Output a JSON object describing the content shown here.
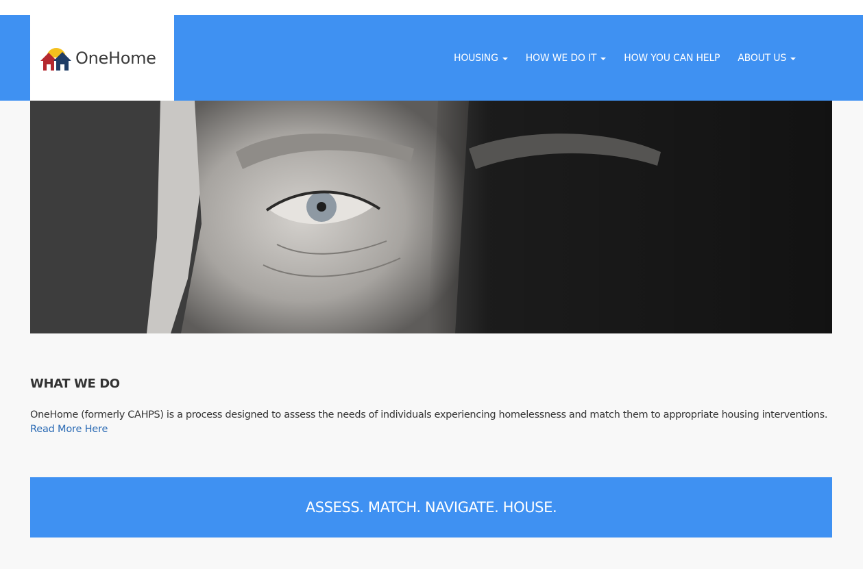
{
  "brand": {
    "name": "OneHome",
    "colors": {
      "nav_blue": "#3f91f2",
      "roof_red": "#b5282e",
      "roof_navy": "#1f3d66",
      "sun_yellow": "#f4c01e",
      "link_blue": "#2a6ab4"
    }
  },
  "nav": {
    "items": [
      {
        "label": "HOUSING",
        "dropdown": true
      },
      {
        "label": "HOW WE DO IT",
        "dropdown": true
      },
      {
        "label": "HOW YOU CAN HELP",
        "dropdown": false
      },
      {
        "label": "ABOUT US",
        "dropdown": true
      }
    ]
  },
  "hero": {
    "image": "close-up of an elderly man's face, black and white"
  },
  "what_we_do": {
    "title": "WHAT WE DO",
    "description": "OneHome (formerly CAHPS) is a process designed to assess the needs of individuals experiencing homelessness and match them to appropriate housing interventions.",
    "link_label": "Read More Here"
  },
  "banner": {
    "text": "ASSESS. MATCH. NAVIGATE. HOUSE."
  }
}
